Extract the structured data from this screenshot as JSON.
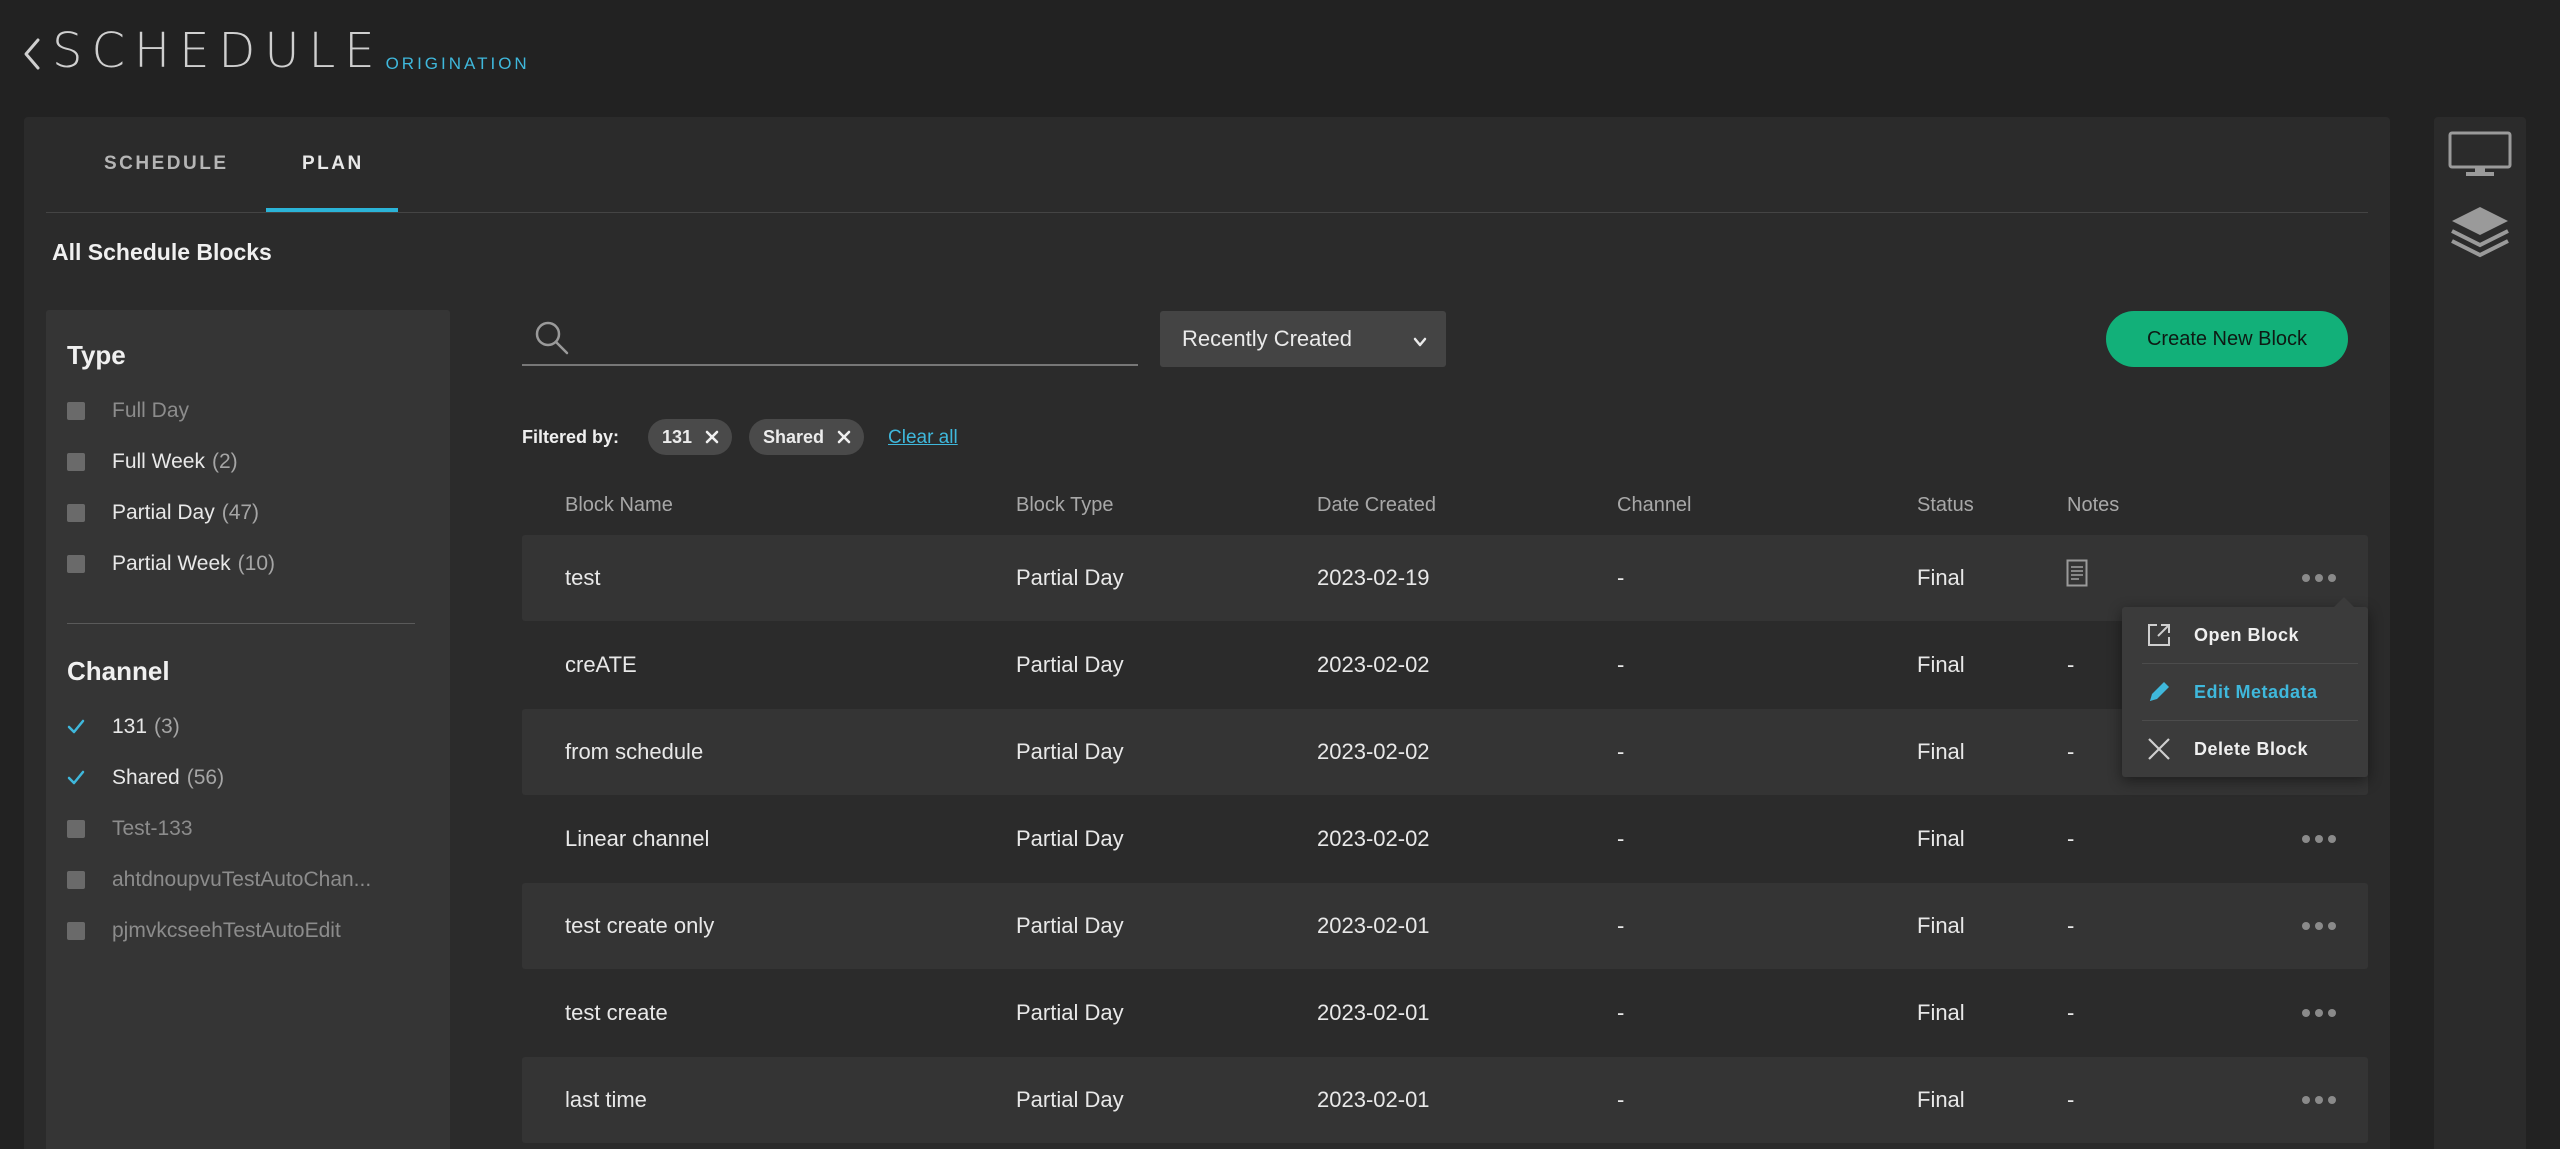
{
  "header": {
    "title": "SCHEDULE",
    "subtitle": "ORIGINATION"
  },
  "tabs": [
    {
      "label": "SCHEDULE",
      "active": false
    },
    {
      "label": "PLAN",
      "active": true
    }
  ],
  "section_title": "All Schedule Blocks",
  "sidebar": {
    "type_title": "Type",
    "type_items": [
      {
        "label": "Full Day",
        "count": "",
        "checked": false,
        "disabled": true
      },
      {
        "label": "Full Week",
        "count": "(2)",
        "checked": false,
        "disabled": false
      },
      {
        "label": "Partial Day",
        "count": "(47)",
        "checked": false,
        "disabled": false
      },
      {
        "label": "Partial Week",
        "count": "(10)",
        "checked": false,
        "disabled": false
      }
    ],
    "channel_title": "Channel",
    "channel_items": [
      {
        "label": "131",
        "count": "(3)",
        "checked": true,
        "disabled": false
      },
      {
        "label": "Shared",
        "count": "(56)",
        "checked": true,
        "disabled": false
      },
      {
        "label": "Test-133",
        "count": "",
        "checked": false,
        "disabled": true
      },
      {
        "label": "ahtdnoupvuTestAutoChan...",
        "count": "",
        "checked": false,
        "disabled": true
      },
      {
        "label": "pjmvkcseehTestAutoEdit",
        "count": "",
        "checked": false,
        "disabled": true
      }
    ]
  },
  "search": {
    "placeholder": "",
    "value": ""
  },
  "sort": {
    "selected": "Recently Created"
  },
  "create_button": "Create New Block",
  "filters": {
    "label": "Filtered by:",
    "chips": [
      "131",
      "Shared"
    ],
    "clear_all": "Clear all"
  },
  "table": {
    "headers": [
      "Block Name",
      "Block Type",
      "Date Created",
      "Channel",
      "Status",
      "Notes"
    ],
    "rows": [
      {
        "name": "test",
        "type": "Partial Day",
        "date": "2023-02-19",
        "channel": "-",
        "status": "Final",
        "notes": "",
        "has_notes_icon": true,
        "menu_open": true
      },
      {
        "name": "creATE",
        "type": "Partial Day",
        "date": "2023-02-02",
        "channel": "-",
        "status": "Final",
        "notes": "-",
        "has_notes_icon": false
      },
      {
        "name": "from schedule",
        "type": "Partial Day",
        "date": "2023-02-02",
        "channel": "-",
        "status": "Final",
        "notes": "-",
        "has_notes_icon": false
      },
      {
        "name": "Linear channel",
        "type": "Partial Day",
        "date": "2023-02-02",
        "channel": "-",
        "status": "Final",
        "notes": "-",
        "has_notes_icon": false
      },
      {
        "name": "test create only",
        "type": "Partial Day",
        "date": "2023-02-01",
        "channel": "-",
        "status": "Final",
        "notes": "-",
        "has_notes_icon": false
      },
      {
        "name": "test create",
        "type": "Partial Day",
        "date": "2023-02-01",
        "channel": "-",
        "status": "Final",
        "notes": "-",
        "has_notes_icon": false
      },
      {
        "name": "last time",
        "type": "Partial Day",
        "date": "2023-02-01",
        "channel": "-",
        "status": "Final",
        "notes": "-",
        "has_notes_icon": false
      }
    ]
  },
  "context_menu": {
    "items": [
      {
        "label": "Open Block",
        "icon": "external-link-icon",
        "highlighted": false
      },
      {
        "label": "Edit Metadata",
        "icon": "pencil-icon",
        "highlighted": true
      },
      {
        "label": "Delete Block",
        "icon": "close-icon",
        "highlighted": false
      }
    ]
  },
  "right_rail": {
    "icons": [
      "monitor-icon",
      "layers-icon"
    ]
  },
  "colors": {
    "accent": "#3fb8dc",
    "primary_button": "#12b079",
    "background": "#222222",
    "panel": "#2b2b2b"
  }
}
